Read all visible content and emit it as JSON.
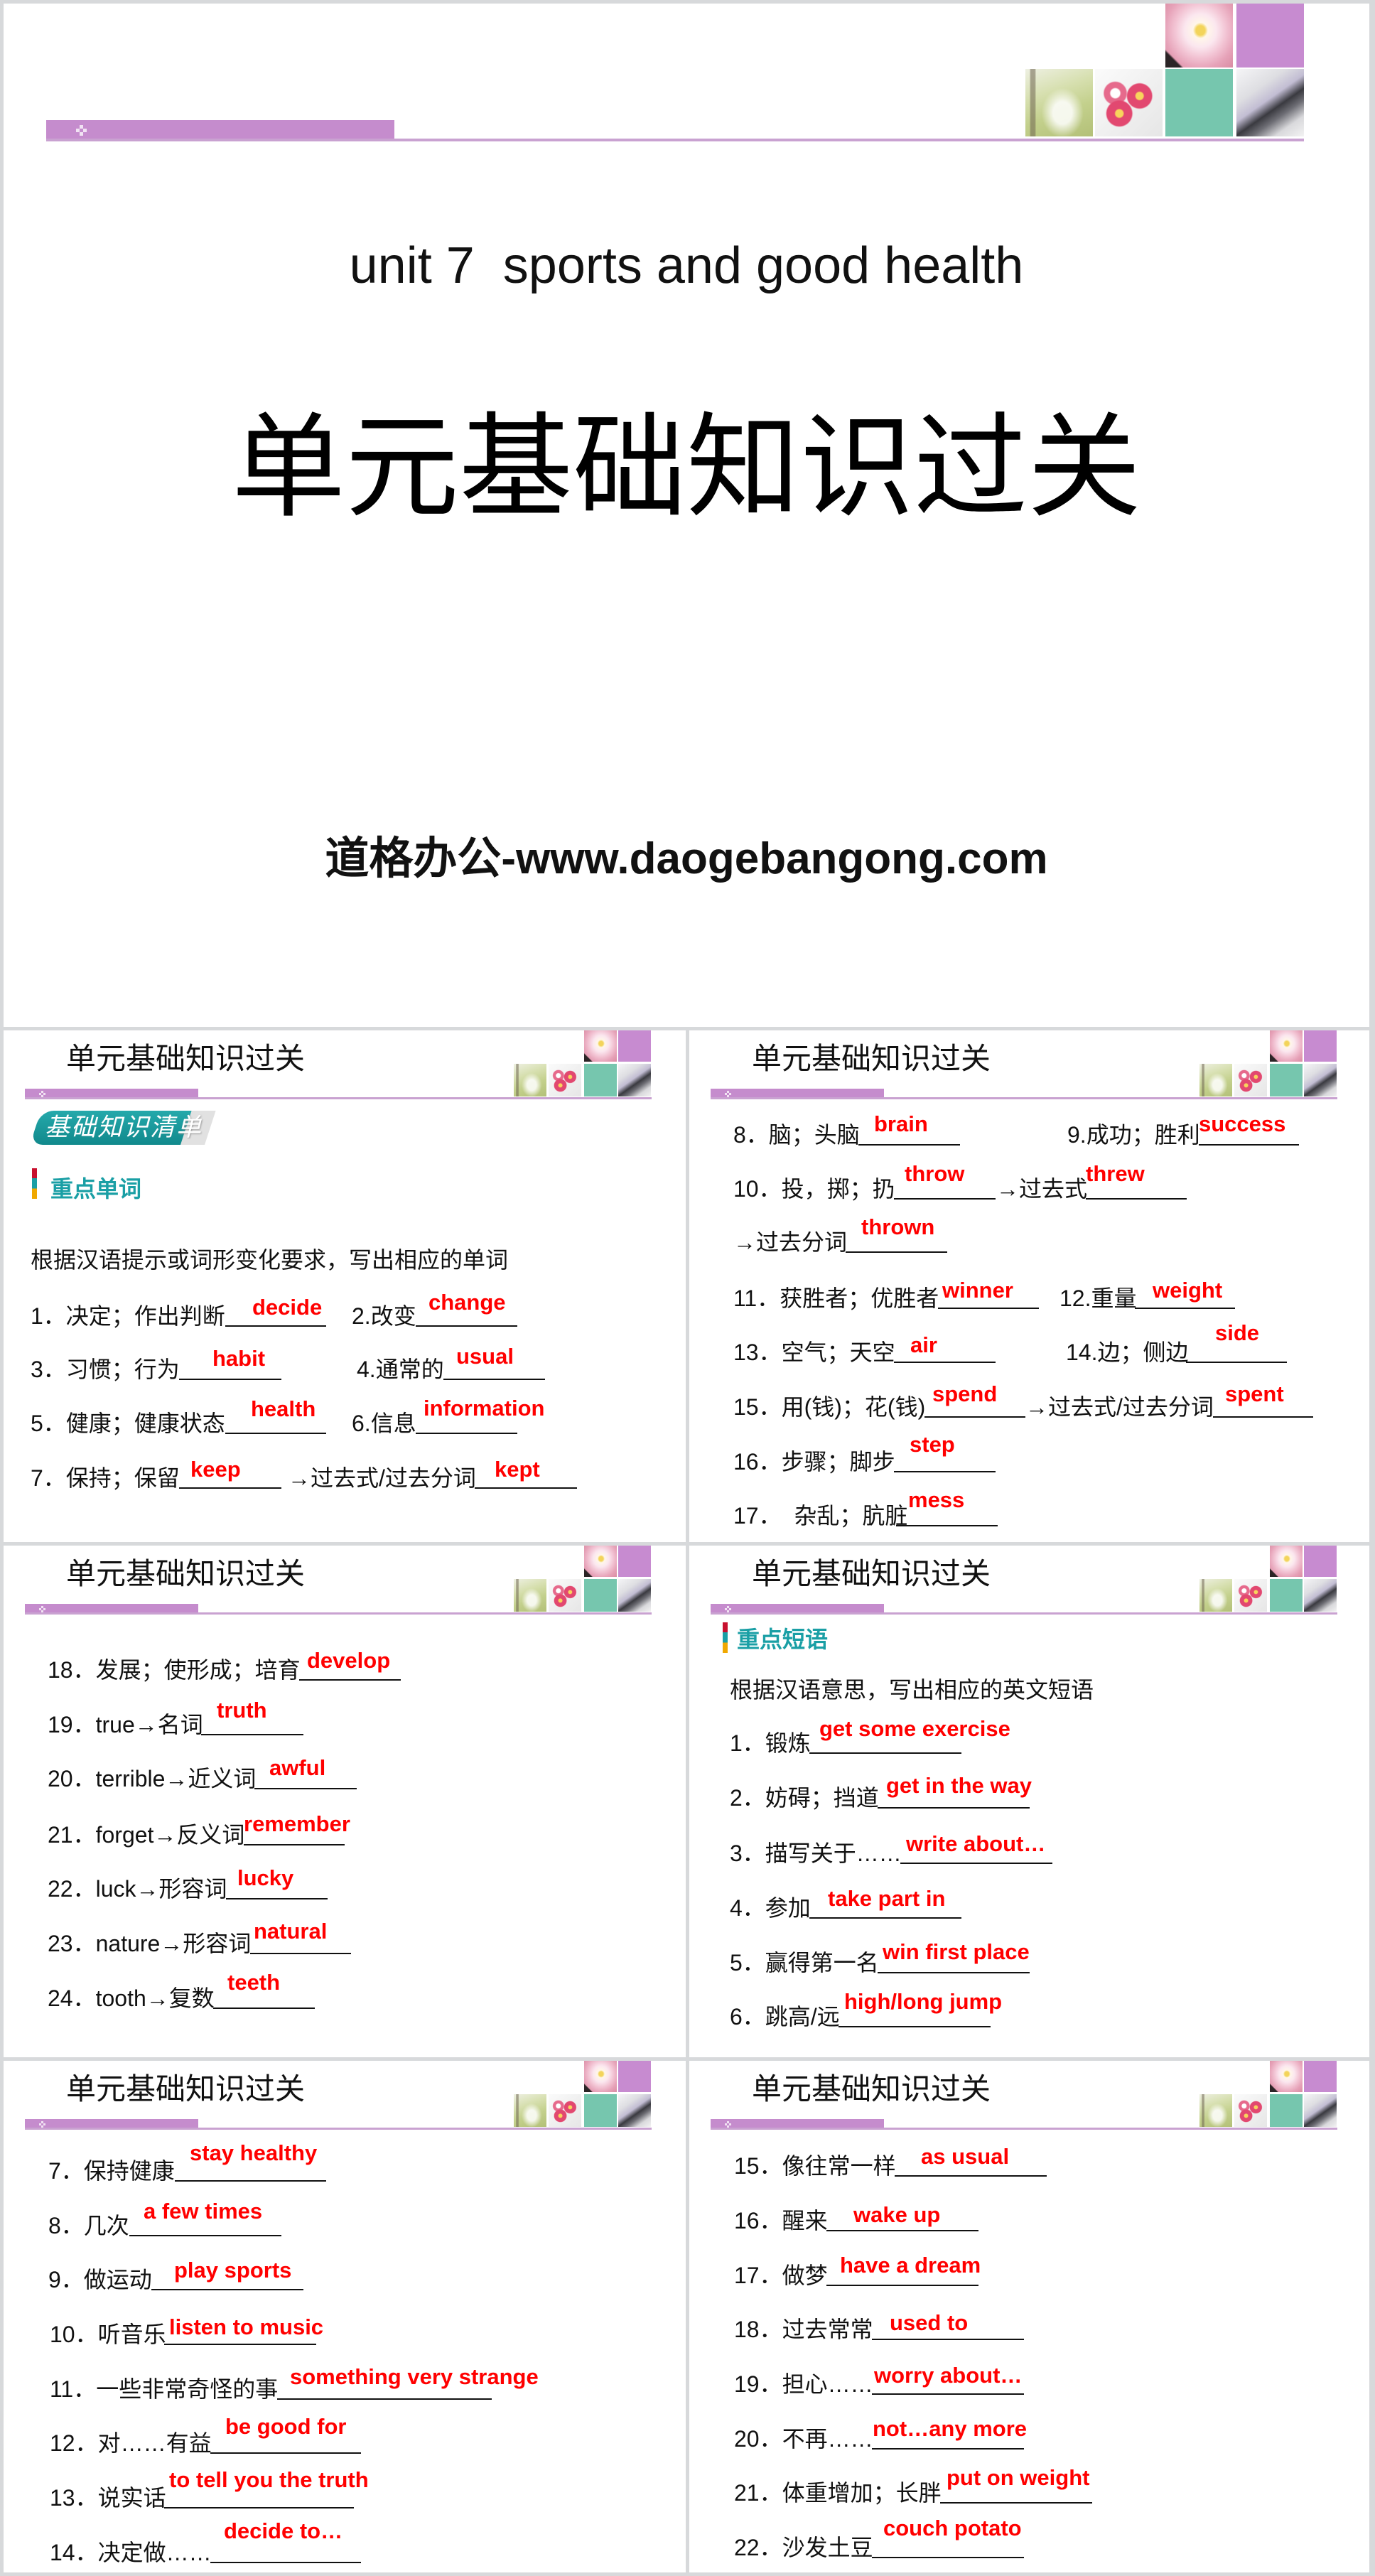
{
  "colors": {
    "page_bg": "#d7d9db",
    "accent_purple": "#c58ccd",
    "rule_purple": "#c9a2d1",
    "tile_purple": "#c78bd0",
    "tile_teal": "#76c6ae",
    "heading_teal": "#1a9fa5",
    "answer_red": "#ff0000",
    "marker_red": "#c8102e",
    "marker_yellow": "#f0a800"
  },
  "decor_tiles": [
    "flower-photo",
    "purple-block",
    "glassware-photo",
    "dumbbell-photo",
    "teal-block",
    "makeup-photo"
  ],
  "title_slide": {
    "subtitle": "unit 7  sports and good health",
    "title": "单元基础知识过关",
    "website": "道格办公-www.daogebangong.com"
  },
  "slide_title": "单元基础知识过关",
  "slides": [
    {
      "badge": {
        "main": "基础知识清",
        "tail": "单"
      },
      "section": "重点单词",
      "instruction": "根据汉语提示或词形变化要求，写出相应的单词",
      "items": [
        {
          "prompt": "1．决定；作出判断",
          "answer": "decide"
        },
        {
          "prompt": "2.改变",
          "answer": "change"
        },
        {
          "prompt": "3．习惯；行为",
          "answer": "habit"
        },
        {
          "prompt": "4.通常的",
          "answer": "usual"
        },
        {
          "prompt": "5．健康；健康状态",
          "answer": "health"
        },
        {
          "prompt": "6.信息",
          "answer": "information"
        },
        {
          "prompt": "7．保持；保留",
          "answer": "keep"
        },
        {
          "prompt": "→过去式/过去分词",
          "answer": "kept"
        }
      ]
    },
    {
      "items": [
        {
          "prompt": "8．脑；头脑",
          "answer": "brain"
        },
        {
          "prompt": "9.成功；胜利",
          "answer": "success"
        },
        {
          "prompt": "10．投，掷；扔",
          "answer": "throw"
        },
        {
          "prompt": "→过去式",
          "answer": "threw"
        },
        {
          "prompt": "→过去分词",
          "answer": "thrown"
        },
        {
          "prompt": "11．获胜者；优胜者",
          "answer": "winner"
        },
        {
          "prompt": "12.重量",
          "answer": "weight"
        },
        {
          "prompt": "13．空气；天空",
          "answer": "air"
        },
        {
          "prompt": "14.边；侧边",
          "answer": "side"
        },
        {
          "prompt": "15．用(钱)；花(钱)",
          "answer": "spend"
        },
        {
          "prompt": "→过去式/过去分词",
          "answer": "spent"
        },
        {
          "prompt": "16．步骤；脚步",
          "answer": "step"
        },
        {
          "prompt": "17．  杂乱；肮脏",
          "answer": "mess"
        }
      ]
    },
    {
      "items": [
        {
          "prompt": "18．发展；使形成；培育",
          "answer": "develop"
        },
        {
          "prompt": "19．true→名词",
          "answer": "truth"
        },
        {
          "prompt": "20．terrible→近义词",
          "answer": "awful"
        },
        {
          "prompt": "21．forget→反义词",
          "answer": "remember"
        },
        {
          "prompt": "22．luck→形容词",
          "answer": "lucky"
        },
        {
          "prompt": "23．nature→形容词",
          "answer": "natural"
        },
        {
          "prompt": "24．tooth→复数",
          "answer": "teeth"
        }
      ]
    },
    {
      "section": "重点短语",
      "instruction": "根据汉语意思，写出相应的英文短语",
      "items": [
        {
          "prompt": "1．锻炼",
          "answer": "get some exercise"
        },
        {
          "prompt": "2．妨碍；挡道",
          "answer": "get in the way"
        },
        {
          "prompt": "3．描写关于……",
          "answer": "write about…"
        },
        {
          "prompt": "4．参加",
          "answer": "take part in"
        },
        {
          "prompt": "5．赢得第一名",
          "answer": "win first place"
        },
        {
          "prompt": "6．跳高/远",
          "answer": "high/long jump"
        }
      ]
    },
    {
      "items": [
        {
          "prompt": "7．保持健康",
          "answer": "stay healthy"
        },
        {
          "prompt": "8．几次",
          "answer": "a few times"
        },
        {
          "prompt": "9．做运动",
          "answer": "play sports"
        },
        {
          "prompt": "10．听音乐",
          "answer": "listen to music"
        },
        {
          "prompt": "11．一些非常奇怪的事",
          "answer": "something very strange"
        },
        {
          "prompt": "12．对……有益",
          "answer": "be good for"
        },
        {
          "prompt": "13．说实话",
          "answer": "to tell you the truth"
        },
        {
          "prompt": "14．决定做……",
          "answer": "decide to…"
        }
      ]
    },
    {
      "items": [
        {
          "prompt": "15．像往常一样",
          "answer": "as usual"
        },
        {
          "prompt": "16．醒来",
          "answer": "wake up"
        },
        {
          "prompt": "17．做梦",
          "answer": "have a dream"
        },
        {
          "prompt": "18．过去常常",
          "answer": "used to"
        },
        {
          "prompt": "19．担心……",
          "answer": "worry about…"
        },
        {
          "prompt": "20．不再……",
          "answer": "not…any more"
        },
        {
          "prompt": "21．体重增加；长胖",
          "answer": "put on weight"
        },
        {
          "prompt": "22．沙发土豆",
          "answer": "couch potato"
        }
      ]
    }
  ]
}
